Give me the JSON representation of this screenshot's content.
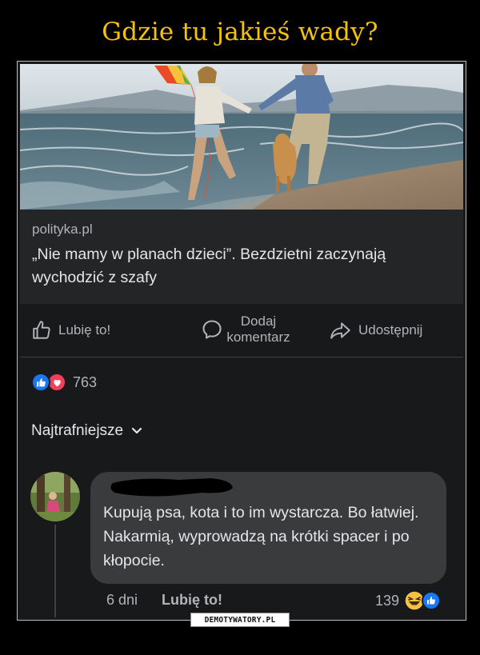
{
  "meme": {
    "title": "Gdzie tu jakieś wady?",
    "watermark": "DEMOTYWATORY.PL"
  },
  "post": {
    "source": "polityka.pl",
    "headline": "„Nie mamy w planach dzieci”. Bezdzietni zaczynają wychodzić z szafy",
    "actions": {
      "like": "Lubię to!",
      "comment": "Dodaj komentarz",
      "share": "Udostępnij"
    },
    "reactions": {
      "count": "763",
      "types": [
        "like-icon",
        "love-icon"
      ]
    },
    "sort_label": "Najtrafniejsze"
  },
  "comment": {
    "text": "Kupują psa, kota i to im wystarcza. Bo łatwiej. Nakarmią, wyprowadzą na krótki spacer i po kłopocie.",
    "time": "6 dni",
    "like_label": "Lubię to!",
    "reaction_count": "139",
    "reaction_types": [
      "haha-icon",
      "like-icon"
    ]
  },
  "colors": {
    "title": "#f4c20d",
    "background": "#18191a",
    "surface": "#242526",
    "bubble": "#3a3b3c",
    "text_primary": "#e4e6eb",
    "text_secondary": "#b0b3b8",
    "like_blue": "#1877f2",
    "love_red": "#f33e58"
  }
}
